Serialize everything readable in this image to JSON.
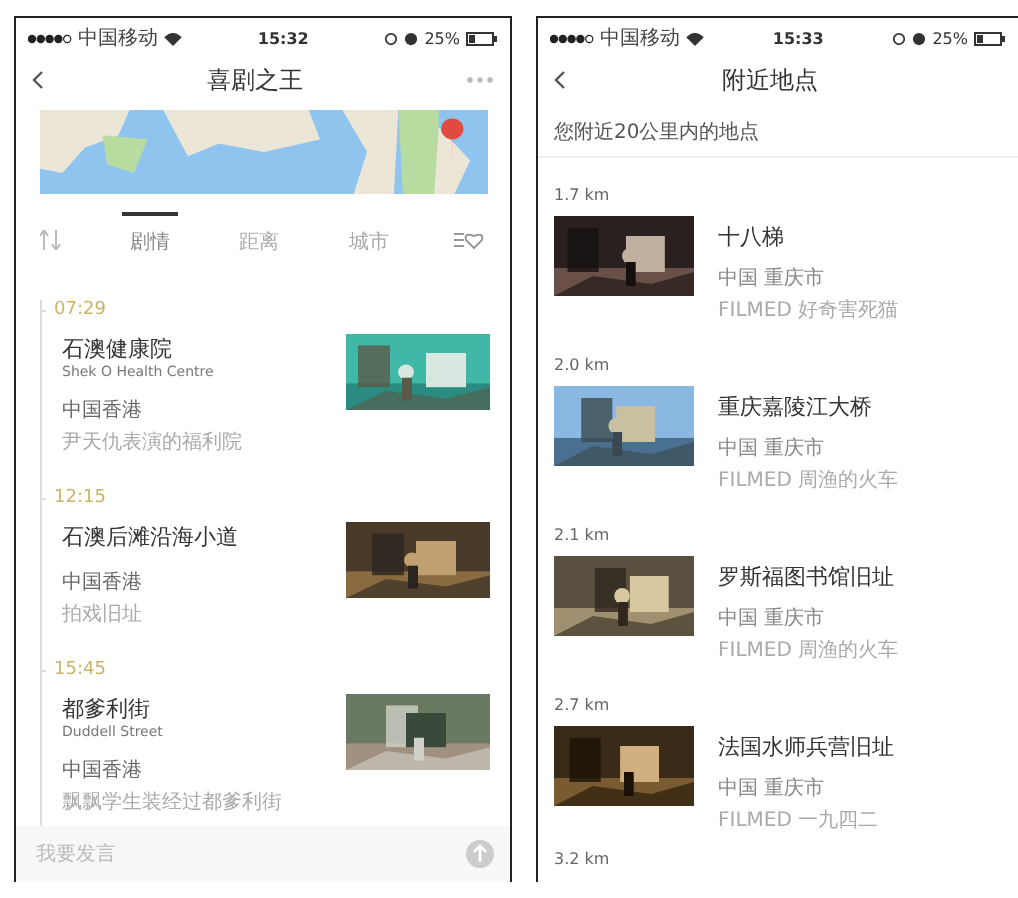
{
  "left": {
    "status": {
      "carrier": "中国移动",
      "time": "15:32",
      "battery": "25%"
    },
    "title": "喜剧之王",
    "tabs": [
      {
        "kind": "sort",
        "selected": false
      },
      {
        "kind": "text",
        "label": "剧情",
        "selected": true
      },
      {
        "kind": "text",
        "label": "距离",
        "selected": false
      },
      {
        "kind": "text",
        "label": "城市",
        "selected": false
      },
      {
        "kind": "favorites",
        "selected": false
      }
    ],
    "timeline": [
      {
        "time": "07:29",
        "name": "石澳健康院",
        "name_en": "Shek O Health Centre",
        "region": "中国香港",
        "note": "尹天仇表演的福利院"
      },
      {
        "time": "12:15",
        "name": "石澳后滩沿海小道",
        "region": "中国香港",
        "note": "拍戏旧址"
      },
      {
        "time": "15:45",
        "name": "都爹利街",
        "name_en": "Duddell Street",
        "region": "中国香港",
        "note": "飘飘学生装经过都爹利街"
      }
    ],
    "comment": {
      "placeholder": "我要发言"
    }
  },
  "right": {
    "status": {
      "carrier": "中国移动",
      "time": "15:33",
      "battery": "25%"
    },
    "title": "附近地点",
    "subtitle": "您附近20公里内的地点",
    "places": [
      {
        "distance": "1.7 km",
        "name": "十八梯",
        "region": "中国 重庆市",
        "film": "FILMED 好奇害死猫"
      },
      {
        "distance": "2.0 km",
        "name": "重庆嘉陵江大桥",
        "region": "中国 重庆市",
        "film": "FILMED 周渔的火车"
      },
      {
        "distance": "2.1 km",
        "name": "罗斯福图书馆旧址",
        "region": "中国 重庆市",
        "film": "FILMED 周渔的火车"
      },
      {
        "distance": "2.7 km",
        "name": "法国水师兵营旧址",
        "region": "中国 重庆市",
        "film": "FILMED 一九四二"
      }
    ],
    "next_distance": "3.2 km"
  }
}
